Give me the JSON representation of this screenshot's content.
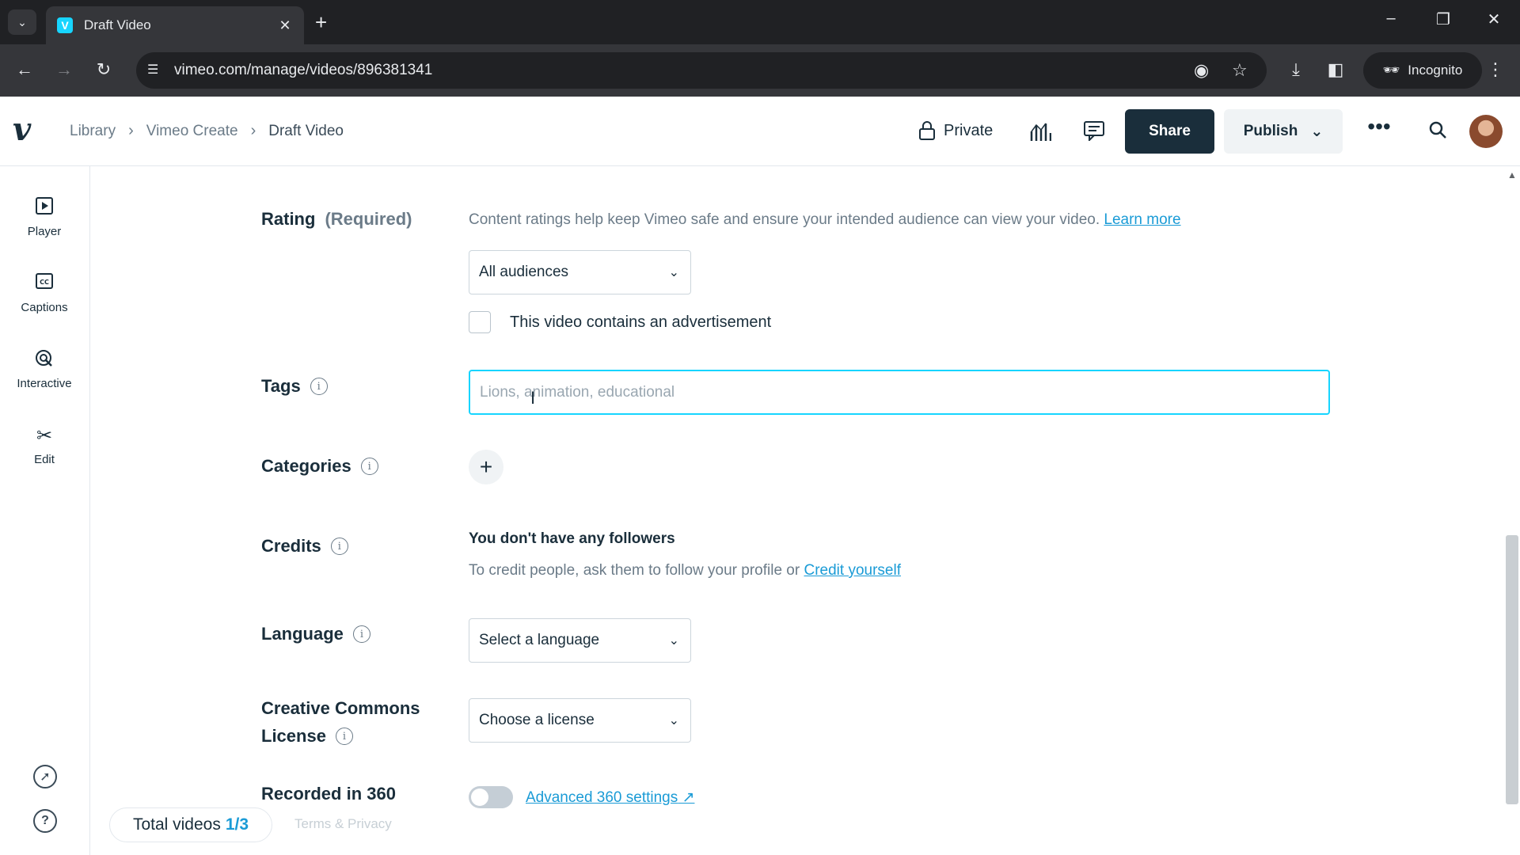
{
  "browser": {
    "tab_title": "Draft Video",
    "url": "vimeo.com/manage/videos/896381341",
    "incognito_label": "Incognito"
  },
  "header": {
    "breadcrumb": [
      "Library",
      "Vimeo Create",
      "Draft Video"
    ],
    "privacy_label": "Private",
    "share_label": "Share",
    "publish_label": "Publish"
  },
  "sidebar": {
    "items": [
      {
        "label": "Player",
        "icon": "play-icon"
      },
      {
        "label": "Captions",
        "icon": "cc-icon"
      },
      {
        "label": "Interactive",
        "icon": "interactive-icon"
      },
      {
        "label": "Edit",
        "icon": "scissors-icon"
      }
    ]
  },
  "form": {
    "rating": {
      "label": "Rating",
      "required": "(Required)",
      "help": "Content ratings help keep Vimeo safe and ensure your intended audience can view your video.",
      "learn_more": "Learn more",
      "value": "All audiences",
      "ad_checkbox_label": "This video contains an advertisement"
    },
    "tags": {
      "label": "Tags",
      "placeholder": "Lions, animation, educational"
    },
    "categories": {
      "label": "Categories",
      "add_symbol": "+"
    },
    "credits": {
      "label": "Credits",
      "title": "You don't have any followers",
      "help": "To credit people, ask them to follow your profile or",
      "link": "Credit yourself"
    },
    "language": {
      "label": "Language",
      "value": "Select a language"
    },
    "license": {
      "label_line1": "Creative Commons",
      "label_line2": "License",
      "value": "Choose a license"
    },
    "recorded360": {
      "label": "Recorded in 360",
      "link": "Advanced 360 settings"
    }
  },
  "footer": {
    "total_label": "Total videos",
    "total_count": "1/3",
    "terms": "Terms & Privacy"
  },
  "colors": {
    "accent": "#17d5ff",
    "link": "#1a9bd6",
    "dark": "#1a2e3b"
  }
}
